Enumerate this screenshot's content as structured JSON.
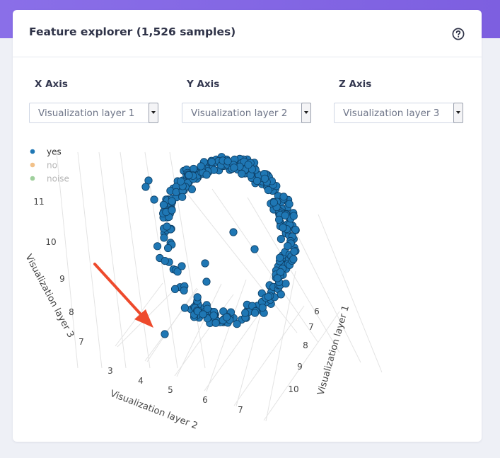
{
  "card": {
    "title": "Feature explorer (1,526 samples)",
    "help_icon": "question-circle-icon"
  },
  "axes_controls": [
    {
      "label": "X Axis",
      "selected": "Visualization layer 1"
    },
    {
      "label": "Y Axis",
      "selected": "Visualization layer 2"
    },
    {
      "label": "Z Axis",
      "selected": "Visualization layer 3"
    }
  ],
  "colors": {
    "header_band": "#8a6fe8",
    "yes": "#1f77b4",
    "no": "#f2c189",
    "noise": "#9fcf9c",
    "annotation_arrow": "#ee4a2c"
  },
  "chart_data": {
    "type": "scatter",
    "dimensions": 3,
    "legend": [
      "yes",
      "no",
      "noise"
    ],
    "x_title": "Visualization layer 1",
    "y_title": "Visualization layer 2",
    "z_title": "Visualization layer 3",
    "x_ticks": [
      "6",
      "7",
      "8",
      "9",
      "10"
    ],
    "y_ticks": [
      "3",
      "4",
      "5",
      "6",
      "7"
    ],
    "z_ticks": [
      "7",
      "8",
      "9",
      "10",
      "11"
    ],
    "series": [
      {
        "name": "yes",
        "color": "#1f77b4",
        "description": "ring-shaped cluster of points plus one outlier near the corner pointed at by the red arrow"
      },
      {
        "name": "no",
        "color": "#f2c189"
      },
      {
        "name": "noise",
        "color": "#9fcf9c"
      }
    ]
  }
}
